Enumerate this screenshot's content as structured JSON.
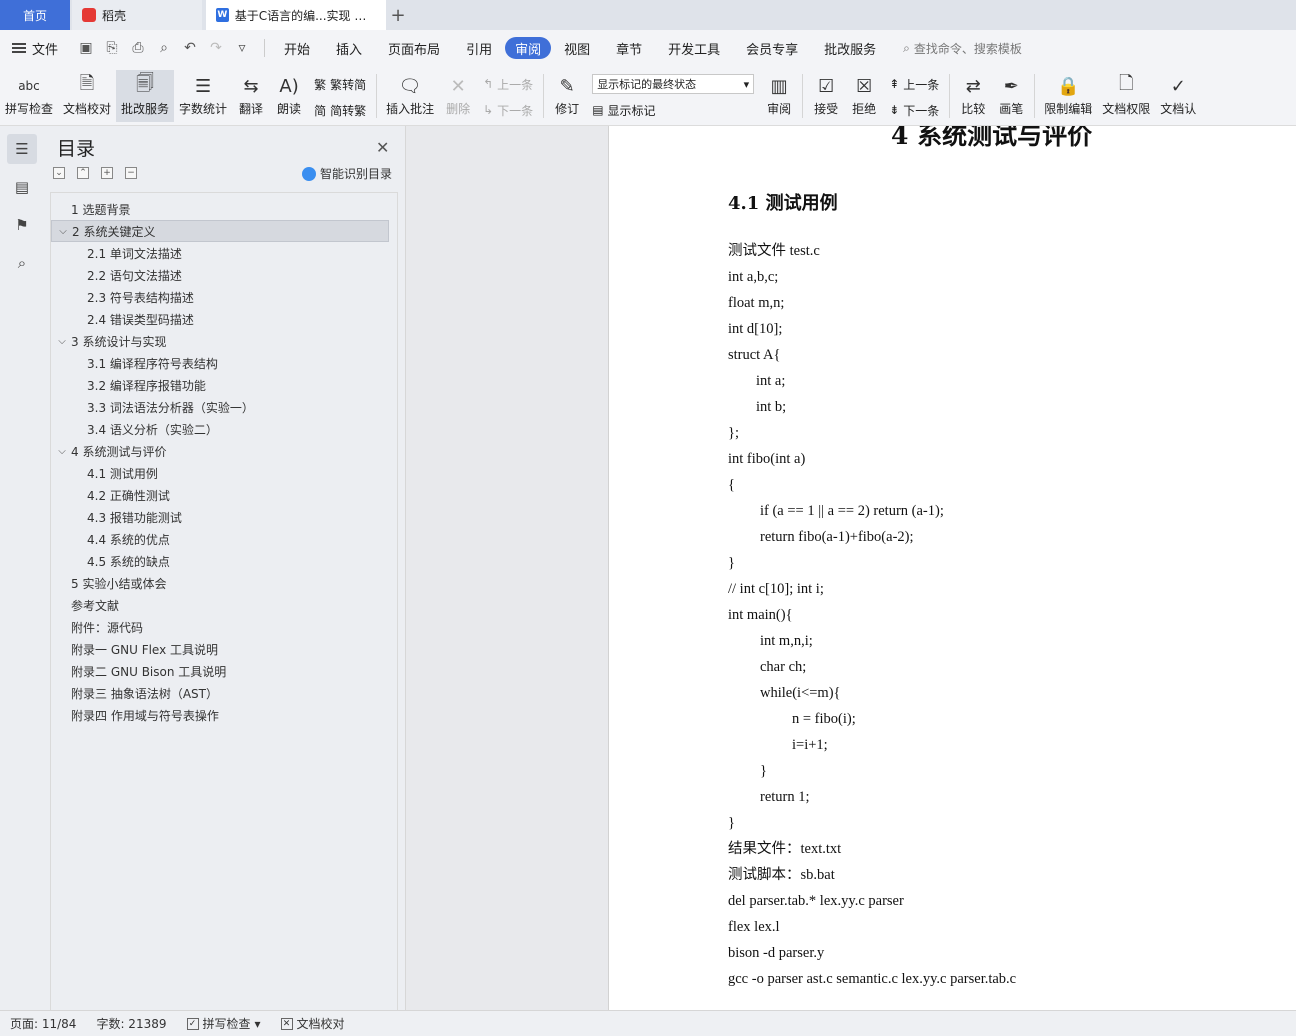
{
  "tabs": {
    "home": "首页",
    "daoke": "稻壳",
    "doc": "基于C语言的编...实现 课程论"
  },
  "menu": {
    "file": "文件",
    "items": [
      "开始",
      "插入",
      "页面布局",
      "引用",
      "审阅",
      "视图",
      "章节",
      "开发工具",
      "会员专享",
      "批改服务"
    ],
    "active": "审阅",
    "search_placeholder": "查找命令、搜索模板"
  },
  "ribbon": {
    "spell": "拼写检查",
    "proofread": "文档校对",
    "grading": "批改服务",
    "wordcount": "字数统计",
    "translate": "翻译",
    "read": "朗读",
    "trad_simp": "繁转简",
    "simp_trad": "简转繁",
    "insert_comment": "插入批注",
    "delete": "删除",
    "prev_comment": "上一条",
    "next_comment": "下一条",
    "track": "修订",
    "markup_state": "显示标记的最终状态",
    "show_markup": "显示标记",
    "review": "审阅",
    "accept": "接受",
    "reject": "拒绝",
    "prev_change": "上一条",
    "next_change": "下一条",
    "compare": "比较",
    "pen": "画笔",
    "restrict": "限制编辑",
    "permission": "文档权限",
    "certify": "文档认"
  },
  "toc": {
    "title": "目录",
    "ai_label": "智能识别目录",
    "items": [
      {
        "label": "1 选题背景",
        "level": 1,
        "chev": ""
      },
      {
        "label": "2 系统关键定义",
        "level": 1,
        "chev": "v"
      },
      {
        "label": "2.1 单词文法描述",
        "level": 2,
        "chev": ""
      },
      {
        "label": "2.2 语句文法描述",
        "level": 2,
        "chev": ""
      },
      {
        "label": "2.3  符号表结构描述",
        "level": 2,
        "chev": ""
      },
      {
        "label": "2.4  错误类型码描述",
        "level": 2,
        "chev": ""
      },
      {
        "label": "3 系统设计与实现",
        "level": 1,
        "chev": "v"
      },
      {
        "label": "3.1 编译程序符号表结构",
        "level": 2,
        "chev": ""
      },
      {
        "label": "3.2 编译程序报错功能",
        "level": 2,
        "chev": ""
      },
      {
        "label": "3.3 词法语法分析器（实验一）",
        "level": 2,
        "chev": ""
      },
      {
        "label": "3.4 语义分析（实验二）",
        "level": 2,
        "chev": ""
      },
      {
        "label": "4 系统测试与评价",
        "level": 1,
        "chev": "v"
      },
      {
        "label": "4.1  测试用例",
        "level": 2,
        "chev": ""
      },
      {
        "label": "4.2  正确性测试",
        "level": 2,
        "chev": ""
      },
      {
        "label": "4.3  报错功能测试",
        "level": 2,
        "chev": ""
      },
      {
        "label": "4.4  系统的优点",
        "level": 2,
        "chev": ""
      },
      {
        "label": "4.5  系统的缺点",
        "level": 2,
        "chev": ""
      },
      {
        "label": "5 实验小结或体会",
        "level": 1,
        "chev": ""
      },
      {
        "label": "参考文献",
        "level": 1,
        "chev": ""
      },
      {
        "label": "附件：源代码",
        "level": 1,
        "chev": ""
      },
      {
        "label": "附录一  GNU Flex  工具说明",
        "level": 1,
        "chev": ""
      },
      {
        "label": "附录二  GNU Bison  工具说明",
        "level": 1,
        "chev": ""
      },
      {
        "label": "附录三  抽象语法树（AST）",
        "level": 1,
        "chev": ""
      },
      {
        "label": "附录四  作用域与符号表操作",
        "level": 1,
        "chev": ""
      }
    ],
    "selected_index": 1
  },
  "document": {
    "heading1": "4 系统测试与评价",
    "heading2": "4.1  测试用例",
    "lines": [
      {
        "text": "测试文件 test.c",
        "indent": 0
      },
      {
        "text": "int a,b,c;",
        "indent": 0
      },
      {
        "text": "float m,n;",
        "indent": 0
      },
      {
        "text": "int d[10];",
        "indent": 0
      },
      {
        "text": "struct A{",
        "indent": 0
      },
      {
        "text": "int a;",
        "indent": 1
      },
      {
        "text": "int b;",
        "indent": 1
      },
      {
        "text": "};",
        "indent": 0
      },
      {
        "text": "int fibo(int a)",
        "indent": 0
      },
      {
        "text": "{",
        "indent": 0
      },
      {
        "text": "if (a == 1 || a == 2) return (a-1);",
        "indent": 2
      },
      {
        "text": "return fibo(a-1)+fibo(a-2);",
        "indent": 2
      },
      {
        "text": "}",
        "indent": 0
      },
      {
        "text": "// int c[10]; int i;",
        "indent": 0
      },
      {
        "text": "int main(){",
        "indent": 0
      },
      {
        "text": "int m,n,i;",
        "indent": 2
      },
      {
        "text": "char ch;",
        "indent": 2
      },
      {
        "text": "while(i<=m){",
        "indent": 2
      },
      {
        "text": "n = fibo(i);",
        "indent": 3
      },
      {
        "text": "i=i+1;",
        "indent": 3
      },
      {
        "text": "}",
        "indent": 2
      },
      {
        "text": "return 1;",
        "indent": 2
      },
      {
        "text": "}",
        "indent": 0
      },
      {
        "text": "结果文件：text.txt",
        "indent": 0
      },
      {
        "text": "测试脚本：sb.bat",
        "indent": 0
      },
      {
        "text": "del parser.tab.* lex.yy.c parser",
        "indent": 0
      },
      {
        "text": "flex lex.l",
        "indent": 0
      },
      {
        "text": "bison -d parser.y",
        "indent": 0
      },
      {
        "text": "gcc -o parser ast.c semantic.c lex.yy.c parser.tab.c",
        "indent": 0
      }
    ]
  },
  "status": {
    "page": "页面: 11/84",
    "words": "字数: 21389",
    "spell": "拼写检查",
    "proof": "文档校对"
  },
  "colors": {
    "accent": "#3f6fd8",
    "tab_bg": "#dfe3ea",
    "panel_bg": "#eceef2"
  }
}
